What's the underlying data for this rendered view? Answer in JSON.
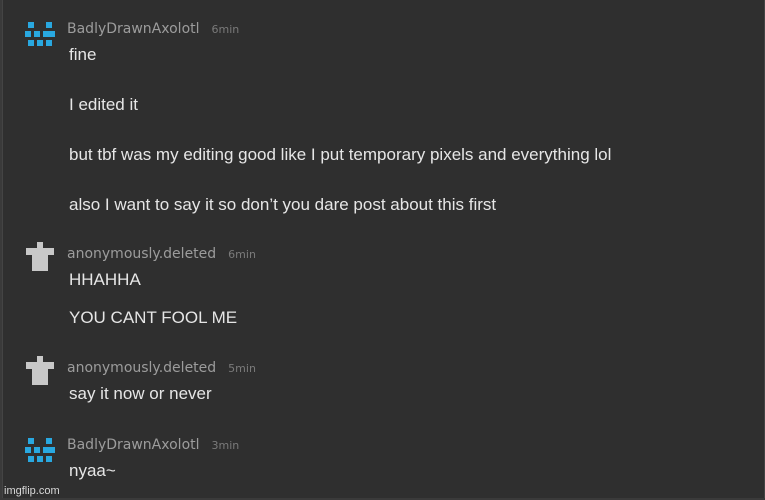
{
  "comments": [
    {
      "username": "BadlyDrawnAxolotl",
      "time": "6min",
      "avatar_icon": "pixel-axolotl-icon",
      "lines": [
        "fine",
        "I edited it",
        "but tbf was my editing good like I put temporary pixels and everything lol",
        "also I want to say it so don’t you dare post about this first"
      ]
    },
    {
      "username": "anonymously.deleted",
      "time": "6min",
      "avatar_icon": "deleted-user-icon",
      "lines": [
        "HHAHHA",
        "YOU CANT FOOL ME"
      ]
    },
    {
      "username": "anonymously.deleted",
      "time": "5min",
      "avatar_icon": "deleted-user-icon",
      "lines": [
        "say it now or never"
      ]
    },
    {
      "username": "BadlyDrawnAxolotl",
      "time": "3min",
      "avatar_icon": "pixel-axolotl-icon",
      "lines": [
        "nyaa~"
      ]
    }
  ],
  "watermark": "imgflip.com",
  "colors": {
    "background": "#2f2f2f",
    "text": "#e6e6e6",
    "username": "#9c9c9c",
    "timestamp": "#7a7a7a",
    "axolotl_avatar": "#29a8e0",
    "deleted_avatar": "#c8c8c8"
  }
}
